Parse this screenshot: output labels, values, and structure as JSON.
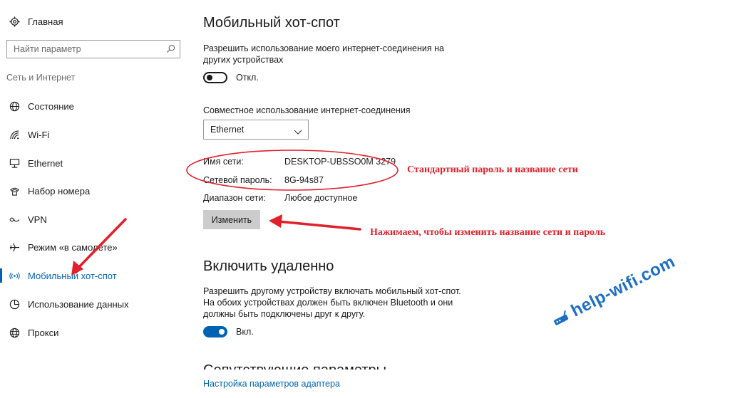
{
  "sidebar": {
    "home": "Главная",
    "search_placeholder": "Найти параметр",
    "section": "Сеть и Интернет",
    "items": [
      {
        "label": "Состояние",
        "icon": "globe-status-icon"
      },
      {
        "label": "Wi-Fi",
        "icon": "wifi-icon"
      },
      {
        "label": "Ethernet",
        "icon": "ethernet-icon"
      },
      {
        "label": "Набор номера",
        "icon": "dialup-icon"
      },
      {
        "label": "VPN",
        "icon": "vpn-icon"
      },
      {
        "label": "Режим «в самолете»",
        "icon": "airplane-icon"
      },
      {
        "label": "Мобильный хот-спот",
        "icon": "hotspot-icon",
        "active": true
      },
      {
        "label": "Использование данных",
        "icon": "data-usage-icon"
      },
      {
        "label": "Прокси",
        "icon": "proxy-icon"
      }
    ]
  },
  "main": {
    "title": "Мобильный хот-спот",
    "share_desc_line1": "Разрешить использование моего интернет-соединения на",
    "share_desc_line2": "других устройствах",
    "share_toggle_state": "Откл.",
    "share_from_label": "Совместное использование интернет-соединения",
    "share_from_value": "Ethernet",
    "network_name_label": "Имя сети:",
    "network_name_value": "DESKTOP-UBSSO0M 3279",
    "password_label": "Сетевой пароль:",
    "password_value": "8G-94s87",
    "band_label": "Диапазон сети:",
    "band_value": "Любое доступное",
    "edit_button": "Изменить",
    "remote_title": "Включить удаленно",
    "remote_desc_line1": "Разрешить другому устройству включать мобильный хот-спот.",
    "remote_desc_line2": "На обоих устройствах должен быть включен Bluetooth и они",
    "remote_desc_line3": "должны быть подключены друг к другу.",
    "remote_toggle_state": "Вкл.",
    "related_title": "Сопутствующие параметры",
    "adapter_link": "Настройка параметров адаптера"
  },
  "annotations": {
    "note_password": "Стандартный пароль и название сети",
    "note_button": "Нажимаем, чтобы изменить название сети и пароль",
    "watermark": "help-wifi.com"
  },
  "colors": {
    "accent": "#0063b1",
    "annotation": "#e0202a"
  }
}
